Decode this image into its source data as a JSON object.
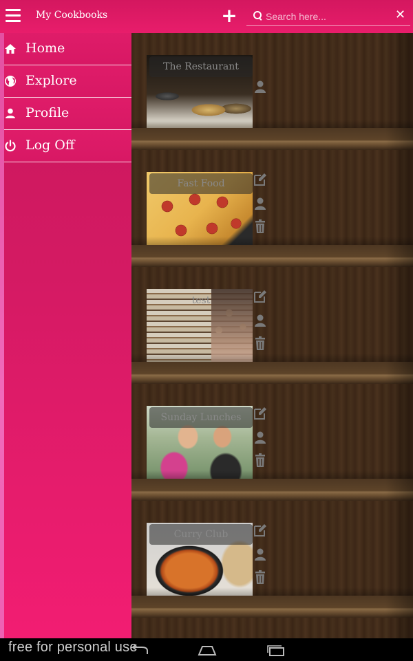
{
  "app": {
    "title": "My Cookbooks",
    "accent_color": "#e81d6b",
    "add_icon": "plus-icon",
    "menu_icon": "hamburger-menu-icon"
  },
  "search": {
    "placeholder": "Search here...",
    "value": "",
    "icon": "search-icon",
    "clear_icon": "close-icon"
  },
  "sidebar": {
    "items": [
      {
        "label": "Home",
        "icon": "home-icon"
      },
      {
        "label": "Explore",
        "icon": "globe-icon"
      },
      {
        "label": "Profile",
        "icon": "person-icon"
      },
      {
        "label": "Log Off",
        "icon": "power-icon"
      }
    ]
  },
  "cookbooks": [
    {
      "title": "The Restaurant",
      "actions": [
        "person-icon"
      ]
    },
    {
      "title": "Fast Food",
      "actions": [
        "edit-icon",
        "person-icon",
        "trash-icon"
      ]
    },
    {
      "title": "test",
      "actions": [
        "edit-icon",
        "person-icon",
        "trash-icon"
      ]
    },
    {
      "title": "Sunday Lunches",
      "actions": [
        "edit-icon",
        "person-icon",
        "trash-icon"
      ]
    },
    {
      "title": "Curry Club",
      "actions": [
        "edit-icon",
        "person-icon",
        "trash-icon"
      ]
    }
  ],
  "watermark": "free for personal use",
  "system_nav": [
    "back-icon",
    "home-icon",
    "recent-apps-icon"
  ]
}
